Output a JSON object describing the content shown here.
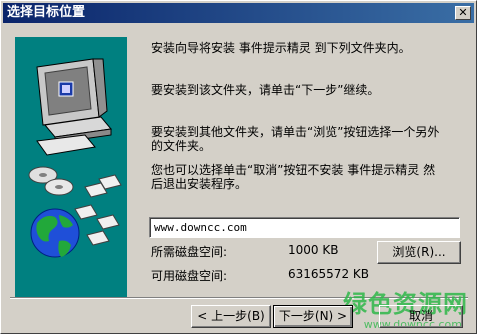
{
  "window": {
    "title": "选择目标位置"
  },
  "messages": {
    "line1": "安装向导将安装 事件提示精灵 到下列文件夹内。",
    "line2": "要安装到该文件夹，请单击“下一步”继续。",
    "line3a": "要安装到其他文件夹，请单击“浏览”按钮选择一个另外",
    "line3b": "的文件夹。",
    "line4a": "您也可以选择单击“取消”按钮不安装 事件提示精灵 然",
    "line4b": "后退出安装程序。"
  },
  "destination": {
    "value": "www.downcc.com"
  },
  "space": {
    "required_label": "所需磁盘空间:",
    "required_value": "1000 KB",
    "available_label": "可用磁盘空间:",
    "available_value": "63165572 KB"
  },
  "buttons": {
    "browse": "浏览(R)...",
    "back": "< 上一步(B)",
    "next": "下一步(N) >",
    "cancel": "取消"
  },
  "watermark": {
    "text": "绿色资源网",
    "url": "www.downcc.com"
  },
  "colors": {
    "sidepanel": "#008080",
    "titlebar": "#0a246a"
  }
}
